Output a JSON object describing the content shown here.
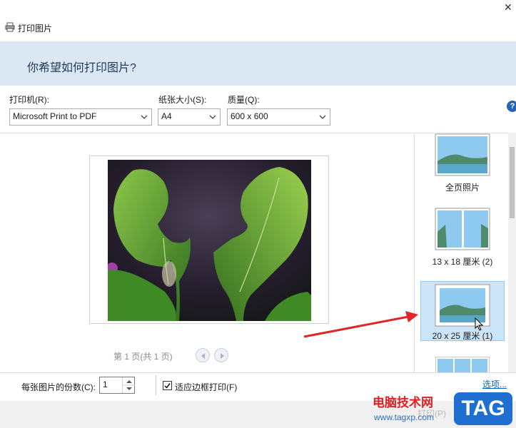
{
  "window": {
    "title": "打印图片",
    "close_glyph": "✕"
  },
  "header": {
    "heading": "你希望如何打印图片?"
  },
  "options": {
    "printer": {
      "label": "打印机(R):",
      "value": "Microsoft Print to PDF"
    },
    "paper": {
      "label": "纸张大小(S):",
      "value": "A4"
    },
    "quality": {
      "label": "质量(Q):",
      "value": "600 x 600"
    },
    "help": "?"
  },
  "preview": {
    "page_indicator": "第 1 页(共 1 页)"
  },
  "layouts": [
    {
      "label": "全页照片"
    },
    {
      "label": "13 x 18 厘米 (2)"
    },
    {
      "label": "20 x 25 厘米 (1)",
      "selected": true
    }
  ],
  "bottom": {
    "copies_label": "每张图片的份数(C):",
    "copies_value": "1",
    "fit_label": "适应边框打印(F)",
    "fit_checked": true,
    "options_link": "选项..."
  },
  "watermark": {
    "cn": "电脑技术网",
    "url": "www.tagxp.com",
    "tag": "TAG",
    "print_ghost": "打印(P)"
  },
  "colors": {
    "header_bg": "#dbe7f3",
    "selected_bg": "#cce4f7",
    "accent": "#2a62b6",
    "arrow": "#e02626"
  }
}
